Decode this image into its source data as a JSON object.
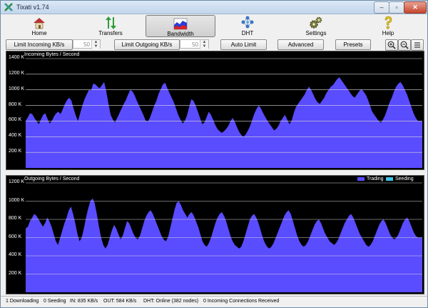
{
  "window": {
    "title": "Tixati v1.74",
    "controls": {
      "minimize": "–",
      "maximize": "▫",
      "close": "✕"
    }
  },
  "toolbar": {
    "items": [
      {
        "label": "Home",
        "icon": "home-icon"
      },
      {
        "label": "Transfers",
        "icon": "transfers-arrows-icon"
      },
      {
        "label": "Bandwidth",
        "icon": "bandwidth-graph-icon",
        "active": true
      },
      {
        "label": "DHT",
        "icon": "dht-network-icon"
      },
      {
        "label": "Settings",
        "icon": "gears-icon"
      },
      {
        "label": "Help",
        "icon": "question-mark-icon"
      }
    ]
  },
  "controls": {
    "limit_incoming_label": "Limit Incoming KB/s",
    "limit_incoming_value": "50",
    "limit_outgoing_label": "Limit Outgoing KB/s",
    "limit_outgoing_value": "50",
    "auto_limit_label": "Auto Limit",
    "advanced_label": "Advanced",
    "presets_label": "Presets",
    "icon_buttons": [
      "zoom-in-icon",
      "zoom-out-icon",
      "list-view-icon"
    ]
  },
  "colors": {
    "trading": "#5a4cff",
    "seeding": "#3fc3e8",
    "graph_bg": "#000000",
    "grid": "#d8d8d8"
  },
  "chart_data": [
    {
      "type": "area",
      "title": "Incoming Bytes / Second",
      "ylim": [
        0,
        1400
      ],
      "yticks": [
        "200 K",
        "400 K",
        "600 K",
        "800 K",
        "1000 K",
        "1200 K",
        "1400 K"
      ],
      "grid": true,
      "series": [
        {
          "values": [
            600,
            650,
            700,
            690,
            640,
            600,
            560,
            620,
            680,
            700,
            630,
            570,
            600,
            660,
            700,
            720,
            690,
            750,
            820,
            870,
            900,
            860,
            760,
            670,
            600,
            700,
            800,
            880,
            940,
            1000,
            990,
            1080,
            1070,
            1040,
            1020,
            1060,
            1100,
            980,
            820,
            680,
            620,
            580,
            640,
            700,
            760,
            820,
            870,
            940,
            1000,
            980,
            930,
            860,
            800,
            740,
            680,
            610,
            590,
            640,
            720,
            800,
            860,
            950,
            1010,
            1070,
            1090,
            1020,
            960,
            900,
            840,
            760,
            680,
            620,
            570,
            600,
            670,
            780,
            880,
            860,
            800,
            720,
            640,
            560,
            580,
            650,
            720,
            680,
            620,
            550,
            500,
            470,
            450,
            470,
            500,
            540,
            600,
            640,
            590,
            520,
            460,
            420,
            400,
            430,
            480,
            540,
            620,
            700,
            760,
            800,
            760,
            700,
            650,
            600,
            560,
            520,
            480,
            500,
            540,
            600,
            640,
            680,
            620,
            560,
            600,
            700,
            780,
            820,
            860,
            900,
            940,
            1000,
            1040,
            1000,
            940,
            880,
            840,
            820,
            860,
            900,
            960,
            1000,
            1040,
            1060,
            1100,
            1140,
            1160,
            1120,
            1080,
            1040,
            1000,
            960,
            920,
            900,
            940,
            980,
            1010,
            980,
            940,
            880,
            800,
            720,
            680,
            640,
            600,
            580,
            620,
            680,
            760,
            840,
            900,
            980,
            1040,
            1080,
            1100,
            1060,
            1000,
            940,
            860,
            780,
            700,
            640,
            600,
            600,
            600
          ]
        }
      ]
    },
    {
      "type": "area",
      "title": "Outgoing Bytes / Second",
      "ylim": [
        0,
        1200
      ],
      "yticks": [
        "200 K",
        "400 K",
        "600 K",
        "800 K",
        "1000 K",
        "1200 K"
      ],
      "grid": true,
      "legend_position": "top-right",
      "series": [
        {
          "name": "Trading",
          "values": [
            700,
            720,
            780,
            820,
            860,
            840,
            800,
            760,
            720,
            760,
            820,
            780,
            720,
            640,
            560,
            520,
            600,
            680,
            760,
            820,
            900,
            940,
            860,
            760,
            640,
            560,
            600,
            700,
            820,
            920,
            1000,
            1030,
            980,
            860,
            720,
            600,
            520,
            480,
            520,
            600,
            680,
            740,
            700,
            640,
            580,
            620,
            700,
            780,
            760,
            700,
            640,
            600,
            580,
            620,
            700,
            780,
            840,
            880,
            900,
            860,
            800,
            740,
            680,
            620,
            580,
            560,
            600,
            700,
            800,
            900,
            980,
            1000,
            960,
            900,
            860,
            820,
            860,
            880,
            840,
            780,
            720,
            640,
            560,
            520,
            500,
            540,
            600,
            680,
            760,
            820,
            860,
            880,
            840,
            780,
            700,
            620,
            560,
            520,
            500,
            480,
            500,
            560,
            640,
            720,
            800,
            840,
            860,
            820,
            760,
            680,
            600,
            540,
            500,
            480,
            500,
            540,
            600,
            660,
            720,
            780,
            840,
            880,
            900,
            860,
            780,
            700,
            620,
            560,
            520,
            500,
            520,
            560,
            620,
            680,
            740,
            780,
            800,
            760,
            700,
            640,
            600,
            560,
            540,
            520,
            540,
            580,
            640,
            700,
            760,
            800,
            840,
            860,
            820,
            760,
            700,
            640,
            600,
            560,
            520,
            500,
            520,
            560,
            620,
            680,
            740,
            780,
            800,
            760,
            700,
            640,
            600,
            580,
            600,
            640,
            700,
            760,
            800,
            820,
            780,
            720,
            660,
            620,
            600,
            600,
            600
          ]
        },
        {
          "name": "Seeding",
          "values": []
        }
      ]
    }
  ],
  "status": {
    "downloading": "1 Downloading",
    "seeding": "0 Seeding",
    "in": "IN: 835 KB/s",
    "out": "OUT: 584 KB/s",
    "dht": "DHT: Online (382 nodes)",
    "incoming": "0 Incoming Connections Received"
  }
}
